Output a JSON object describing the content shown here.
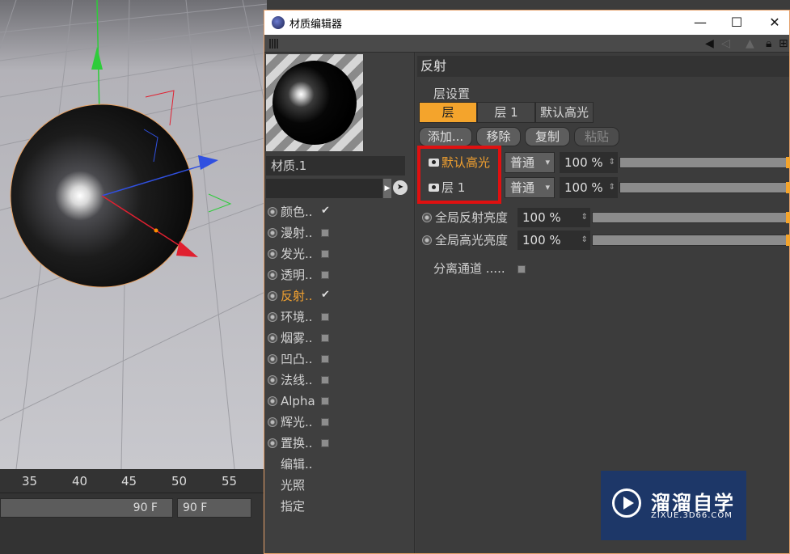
{
  "window": {
    "title": "材质编辑器",
    "controls": {
      "minimize": "—",
      "maximize": "☐",
      "close": "✕"
    }
  },
  "toolbar": {
    "icons": [
      "arrow-left-icon",
      "lock-icon",
      "new-window-icon"
    ]
  },
  "material": {
    "name": "材质.1"
  },
  "channels": [
    {
      "label": "颜色..",
      "checked": true
    },
    {
      "label": "漫射..",
      "checked": false
    },
    {
      "label": "发光..",
      "checked": false
    },
    {
      "label": "透明..",
      "checked": false
    },
    {
      "label": "反射..",
      "checked": true,
      "active": true
    },
    {
      "label": "环境..",
      "checked": false
    },
    {
      "label": "烟雾..",
      "checked": false
    },
    {
      "label": "凹凸..",
      "checked": false
    },
    {
      "label": "法线..",
      "checked": false
    },
    {
      "label": "Alpha",
      "checked": false
    },
    {
      "label": "辉光..",
      "checked": false
    },
    {
      "label": "置换..",
      "checked": false
    }
  ],
  "extra_items": [
    "编辑..",
    "光照",
    "指定"
  ],
  "reflection": {
    "header": "反射",
    "layer_settings": "层设置",
    "tabs": [
      "层",
      "层 1",
      "默认高光"
    ],
    "buttons": {
      "add": "添加...",
      "remove": "移除",
      "copy": "复制",
      "paste": "粘贴"
    },
    "layers": [
      {
        "name": "默认高光",
        "mode": "普通",
        "amount": "100 %",
        "active": true
      },
      {
        "name": "层 1",
        "mode": "普通",
        "amount": "100 %",
        "active": false
      }
    ],
    "global_reflection": {
      "label": "全局反射亮度",
      "value": "100 %"
    },
    "global_specular": {
      "label": "全局高光亮度",
      "value": "100 %"
    },
    "separate_passes": "分离通道 ....."
  },
  "timeline": {
    "ticks": [
      "35",
      "40",
      "45",
      "50",
      "55"
    ],
    "field_end": "90 F",
    "field_current": "90 F"
  },
  "watermark": {
    "title": "溜溜自学",
    "subtitle": "ZIXUE.3D66.COM"
  },
  "colors": {
    "accent": "#f4a42c",
    "highlight_box": "#e01010",
    "active_text": "#f0a030"
  }
}
